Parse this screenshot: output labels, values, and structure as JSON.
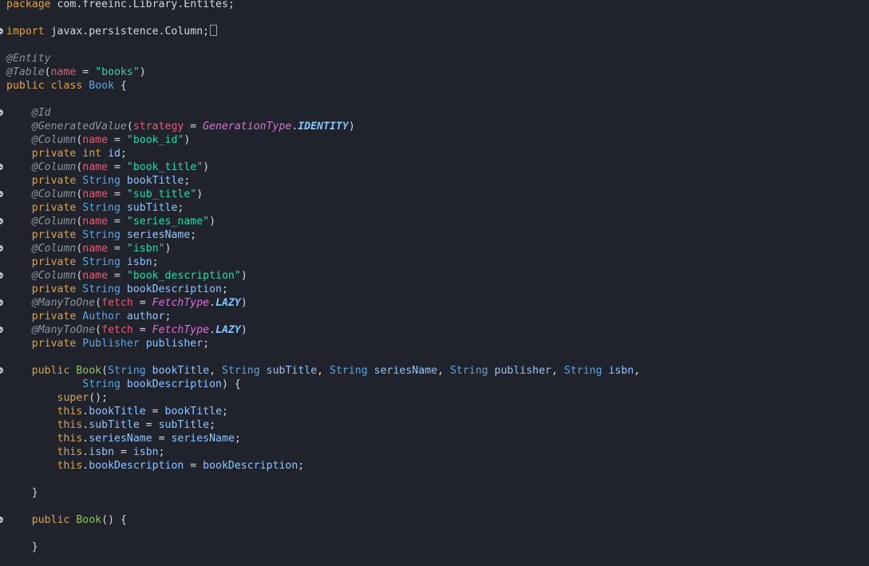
{
  "editor": {
    "language": "java",
    "colors": {
      "background": "#20232b",
      "keyword": "#e0a23c",
      "type": "#5aa6e6",
      "annotation": "#8c93a0",
      "attribute": "#e85a75",
      "string": "#2fd6a8",
      "enum_type": "#d670d6",
      "enum_value": "#7fc7ff",
      "constructor": "#8ac84f",
      "text": "#d3d7e0"
    },
    "lines": [
      {
        "fold": false,
        "tokens": [
          [
            "kw",
            "package"
          ],
          [
            "plain",
            " com.freeinc.Library.Entites;"
          ]
        ]
      },
      {
        "fold": false,
        "tokens": []
      },
      {
        "fold": true,
        "box": true,
        "tokens": [
          [
            "kw",
            "import"
          ],
          [
            "plain",
            " javax.persistence.Column;"
          ]
        ]
      },
      {
        "fold": false,
        "tokens": []
      },
      {
        "fold": false,
        "tokens": [
          [
            "ann",
            "@Entity"
          ]
        ]
      },
      {
        "fold": false,
        "tokens": [
          [
            "ann",
            "@Table"
          ],
          [
            "plain",
            "("
          ],
          [
            "attr",
            "name"
          ],
          [
            "plain",
            " = "
          ],
          [
            "str",
            "\"books\""
          ],
          [
            "plain",
            ")"
          ]
        ]
      },
      {
        "fold": false,
        "tokens": [
          [
            "kw",
            "public"
          ],
          [
            "plain",
            " "
          ],
          [
            "kw",
            "class"
          ],
          [
            "plain",
            " "
          ],
          [
            "type",
            "Book"
          ],
          [
            "plain",
            " {"
          ]
        ]
      },
      {
        "fold": false,
        "tokens": []
      },
      {
        "fold": true,
        "tokens": [
          [
            "plain",
            "    "
          ],
          [
            "ann",
            "@Id"
          ]
        ]
      },
      {
        "fold": false,
        "tokens": [
          [
            "plain",
            "    "
          ],
          [
            "ann",
            "@GeneratedValue"
          ],
          [
            "plain",
            "("
          ],
          [
            "attr",
            "strategy"
          ],
          [
            "plain",
            " = "
          ],
          [
            "enumt",
            "GenerationType"
          ],
          [
            "plain",
            "."
          ],
          [
            "enumv",
            "IDENTITY"
          ],
          [
            "plain",
            ")"
          ]
        ]
      },
      {
        "fold": false,
        "tokens": [
          [
            "plain",
            "    "
          ],
          [
            "ann",
            "@Column"
          ],
          [
            "plain",
            "("
          ],
          [
            "attr",
            "name"
          ],
          [
            "plain",
            " = "
          ],
          [
            "str",
            "\"book_id\""
          ],
          [
            "plain",
            ")"
          ]
        ]
      },
      {
        "fold": false,
        "tokens": [
          [
            "plain",
            "    "
          ],
          [
            "kw",
            "private"
          ],
          [
            "plain",
            " "
          ],
          [
            "kw",
            "int"
          ],
          [
            "plain",
            " "
          ],
          [
            "field",
            "id"
          ],
          [
            "plain",
            ";"
          ]
        ]
      },
      {
        "fold": true,
        "tokens": [
          [
            "plain",
            "    "
          ],
          [
            "ann",
            "@Column"
          ],
          [
            "plain",
            "("
          ],
          [
            "attr",
            "name"
          ],
          [
            "plain",
            " = "
          ],
          [
            "str",
            "\"book_title\""
          ],
          [
            "plain",
            ")"
          ]
        ]
      },
      {
        "fold": false,
        "tokens": [
          [
            "plain",
            "    "
          ],
          [
            "kw",
            "private"
          ],
          [
            "plain",
            " "
          ],
          [
            "type",
            "String"
          ],
          [
            "plain",
            " "
          ],
          [
            "field",
            "bookTitle"
          ],
          [
            "plain",
            ";"
          ]
        ]
      },
      {
        "fold": true,
        "tokens": [
          [
            "plain",
            "    "
          ],
          [
            "ann",
            "@Column"
          ],
          [
            "plain",
            "("
          ],
          [
            "attr",
            "name"
          ],
          [
            "plain",
            " = "
          ],
          [
            "str",
            "\"sub_title\""
          ],
          [
            "plain",
            ")"
          ]
        ]
      },
      {
        "fold": false,
        "tokens": [
          [
            "plain",
            "    "
          ],
          [
            "kw",
            "private"
          ],
          [
            "plain",
            " "
          ],
          [
            "type",
            "String"
          ],
          [
            "plain",
            " "
          ],
          [
            "field",
            "subTitle"
          ],
          [
            "plain",
            ";"
          ]
        ]
      },
      {
        "fold": true,
        "tokens": [
          [
            "plain",
            "    "
          ],
          [
            "ann",
            "@Column"
          ],
          [
            "plain",
            "("
          ],
          [
            "attr",
            "name"
          ],
          [
            "plain",
            " = "
          ],
          [
            "str",
            "\"series_name\""
          ],
          [
            "plain",
            ")"
          ]
        ]
      },
      {
        "fold": false,
        "tokens": [
          [
            "plain",
            "    "
          ],
          [
            "kw",
            "private"
          ],
          [
            "plain",
            " "
          ],
          [
            "type",
            "String"
          ],
          [
            "plain",
            " "
          ],
          [
            "field",
            "seriesName"
          ],
          [
            "plain",
            ";"
          ]
        ]
      },
      {
        "fold": true,
        "tokens": [
          [
            "plain",
            "    "
          ],
          [
            "ann",
            "@Column"
          ],
          [
            "plain",
            "("
          ],
          [
            "attr",
            "name"
          ],
          [
            "plain",
            " = "
          ],
          [
            "str",
            "\"isbn\""
          ],
          [
            "plain",
            ")"
          ]
        ]
      },
      {
        "fold": false,
        "tokens": [
          [
            "plain",
            "    "
          ],
          [
            "kw",
            "private"
          ],
          [
            "plain",
            " "
          ],
          [
            "type",
            "String"
          ],
          [
            "plain",
            " "
          ],
          [
            "field",
            "isbn"
          ],
          [
            "plain",
            ";"
          ]
        ]
      },
      {
        "fold": true,
        "tokens": [
          [
            "plain",
            "    "
          ],
          [
            "ann",
            "@Column"
          ],
          [
            "plain",
            "("
          ],
          [
            "attr",
            "name"
          ],
          [
            "plain",
            " = "
          ],
          [
            "str",
            "\"book_description\""
          ],
          [
            "plain",
            ")"
          ]
        ]
      },
      {
        "fold": false,
        "tokens": [
          [
            "plain",
            "    "
          ],
          [
            "kw",
            "private"
          ],
          [
            "plain",
            " "
          ],
          [
            "type",
            "String"
          ],
          [
            "plain",
            " "
          ],
          [
            "field",
            "bookDescription"
          ],
          [
            "plain",
            ";"
          ]
        ]
      },
      {
        "fold": true,
        "tokens": [
          [
            "plain",
            "    "
          ],
          [
            "ann",
            "@ManyToOne"
          ],
          [
            "plain",
            "("
          ],
          [
            "attr",
            "fetch"
          ],
          [
            "plain",
            " = "
          ],
          [
            "enumt",
            "FetchType"
          ],
          [
            "plain",
            "."
          ],
          [
            "enumv",
            "LAZY"
          ],
          [
            "plain",
            ")"
          ]
        ]
      },
      {
        "fold": false,
        "tokens": [
          [
            "plain",
            "    "
          ],
          [
            "kw",
            "private"
          ],
          [
            "plain",
            " "
          ],
          [
            "type",
            "Author"
          ],
          [
            "plain",
            " "
          ],
          [
            "field",
            "author"
          ],
          [
            "plain",
            ";"
          ]
        ]
      },
      {
        "fold": true,
        "tokens": [
          [
            "plain",
            "    "
          ],
          [
            "ann",
            "@ManyToOne"
          ],
          [
            "plain",
            "("
          ],
          [
            "attr",
            "fetch"
          ],
          [
            "plain",
            " = "
          ],
          [
            "enumt",
            "FetchType"
          ],
          [
            "plain",
            "."
          ],
          [
            "enumv",
            "LAZY"
          ],
          [
            "plain",
            ")"
          ]
        ]
      },
      {
        "fold": false,
        "tokens": [
          [
            "plain",
            "    "
          ],
          [
            "kw",
            "private"
          ],
          [
            "plain",
            " "
          ],
          [
            "type",
            "Publisher"
          ],
          [
            "plain",
            " "
          ],
          [
            "field",
            "publisher"
          ],
          [
            "plain",
            ";"
          ]
        ]
      },
      {
        "fold": false,
        "tokens": []
      },
      {
        "fold": true,
        "tokens": [
          [
            "plain",
            "    "
          ],
          [
            "kw",
            "public"
          ],
          [
            "plain",
            " "
          ],
          [
            "ctor",
            "Book"
          ],
          [
            "plain",
            "("
          ],
          [
            "type",
            "String"
          ],
          [
            "plain",
            " "
          ],
          [
            "param",
            "bookTitle"
          ],
          [
            "plain",
            ", "
          ],
          [
            "type",
            "String"
          ],
          [
            "plain",
            " "
          ],
          [
            "param",
            "subTitle"
          ],
          [
            "plain",
            ", "
          ],
          [
            "type",
            "String"
          ],
          [
            "plain",
            " "
          ],
          [
            "param",
            "seriesName"
          ],
          [
            "plain",
            ", "
          ],
          [
            "type",
            "String"
          ],
          [
            "plain",
            " "
          ],
          [
            "param",
            "publisher"
          ],
          [
            "plain",
            ", "
          ],
          [
            "type",
            "String"
          ],
          [
            "plain",
            " "
          ],
          [
            "param",
            "isbn"
          ],
          [
            "plain",
            ","
          ]
        ]
      },
      {
        "fold": false,
        "tokens": [
          [
            "plain",
            "            "
          ],
          [
            "type",
            "String"
          ],
          [
            "plain",
            " "
          ],
          [
            "param",
            "bookDescription"
          ],
          [
            "plain",
            ") {"
          ]
        ]
      },
      {
        "fold": false,
        "tokens": [
          [
            "plain",
            "        "
          ],
          [
            "kw",
            "super"
          ],
          [
            "plain",
            "();"
          ]
        ]
      },
      {
        "fold": false,
        "tokens": [
          [
            "plain",
            "        "
          ],
          [
            "kw",
            "this"
          ],
          [
            "plain",
            "."
          ],
          [
            "field",
            "bookTitle"
          ],
          [
            "plain",
            " = "
          ],
          [
            "param",
            "bookTitle"
          ],
          [
            "plain",
            ";"
          ]
        ]
      },
      {
        "fold": false,
        "tokens": [
          [
            "plain",
            "        "
          ],
          [
            "kw",
            "this"
          ],
          [
            "plain",
            "."
          ],
          [
            "field",
            "subTitle"
          ],
          [
            "plain",
            " = "
          ],
          [
            "param",
            "subTitle"
          ],
          [
            "plain",
            ";"
          ]
        ]
      },
      {
        "fold": false,
        "tokens": [
          [
            "plain",
            "        "
          ],
          [
            "kw",
            "this"
          ],
          [
            "plain",
            "."
          ],
          [
            "field",
            "seriesName"
          ],
          [
            "plain",
            " = "
          ],
          [
            "param",
            "seriesName"
          ],
          [
            "plain",
            ";"
          ]
        ]
      },
      {
        "fold": false,
        "tokens": [
          [
            "plain",
            "        "
          ],
          [
            "kw",
            "this"
          ],
          [
            "plain",
            "."
          ],
          [
            "field",
            "isbn"
          ],
          [
            "plain",
            " = "
          ],
          [
            "param",
            "isbn"
          ],
          [
            "plain",
            ";"
          ]
        ]
      },
      {
        "fold": false,
        "tokens": [
          [
            "plain",
            "        "
          ],
          [
            "kw",
            "this"
          ],
          [
            "plain",
            "."
          ],
          [
            "field",
            "bookDescription"
          ],
          [
            "plain",
            " = "
          ],
          [
            "param",
            "bookDescription"
          ],
          [
            "plain",
            ";"
          ]
        ]
      },
      {
        "fold": false,
        "tokens": []
      },
      {
        "fold": false,
        "tokens": [
          [
            "plain",
            "    }"
          ]
        ]
      },
      {
        "fold": false,
        "tokens": []
      },
      {
        "fold": true,
        "tokens": [
          [
            "plain",
            "    "
          ],
          [
            "kw",
            "public"
          ],
          [
            "plain",
            " "
          ],
          [
            "ctor",
            "Book"
          ],
          [
            "plain",
            "() {"
          ]
        ]
      },
      {
        "fold": false,
        "tokens": []
      },
      {
        "fold": false,
        "tokens": [
          [
            "plain",
            "    }"
          ]
        ]
      }
    ]
  }
}
